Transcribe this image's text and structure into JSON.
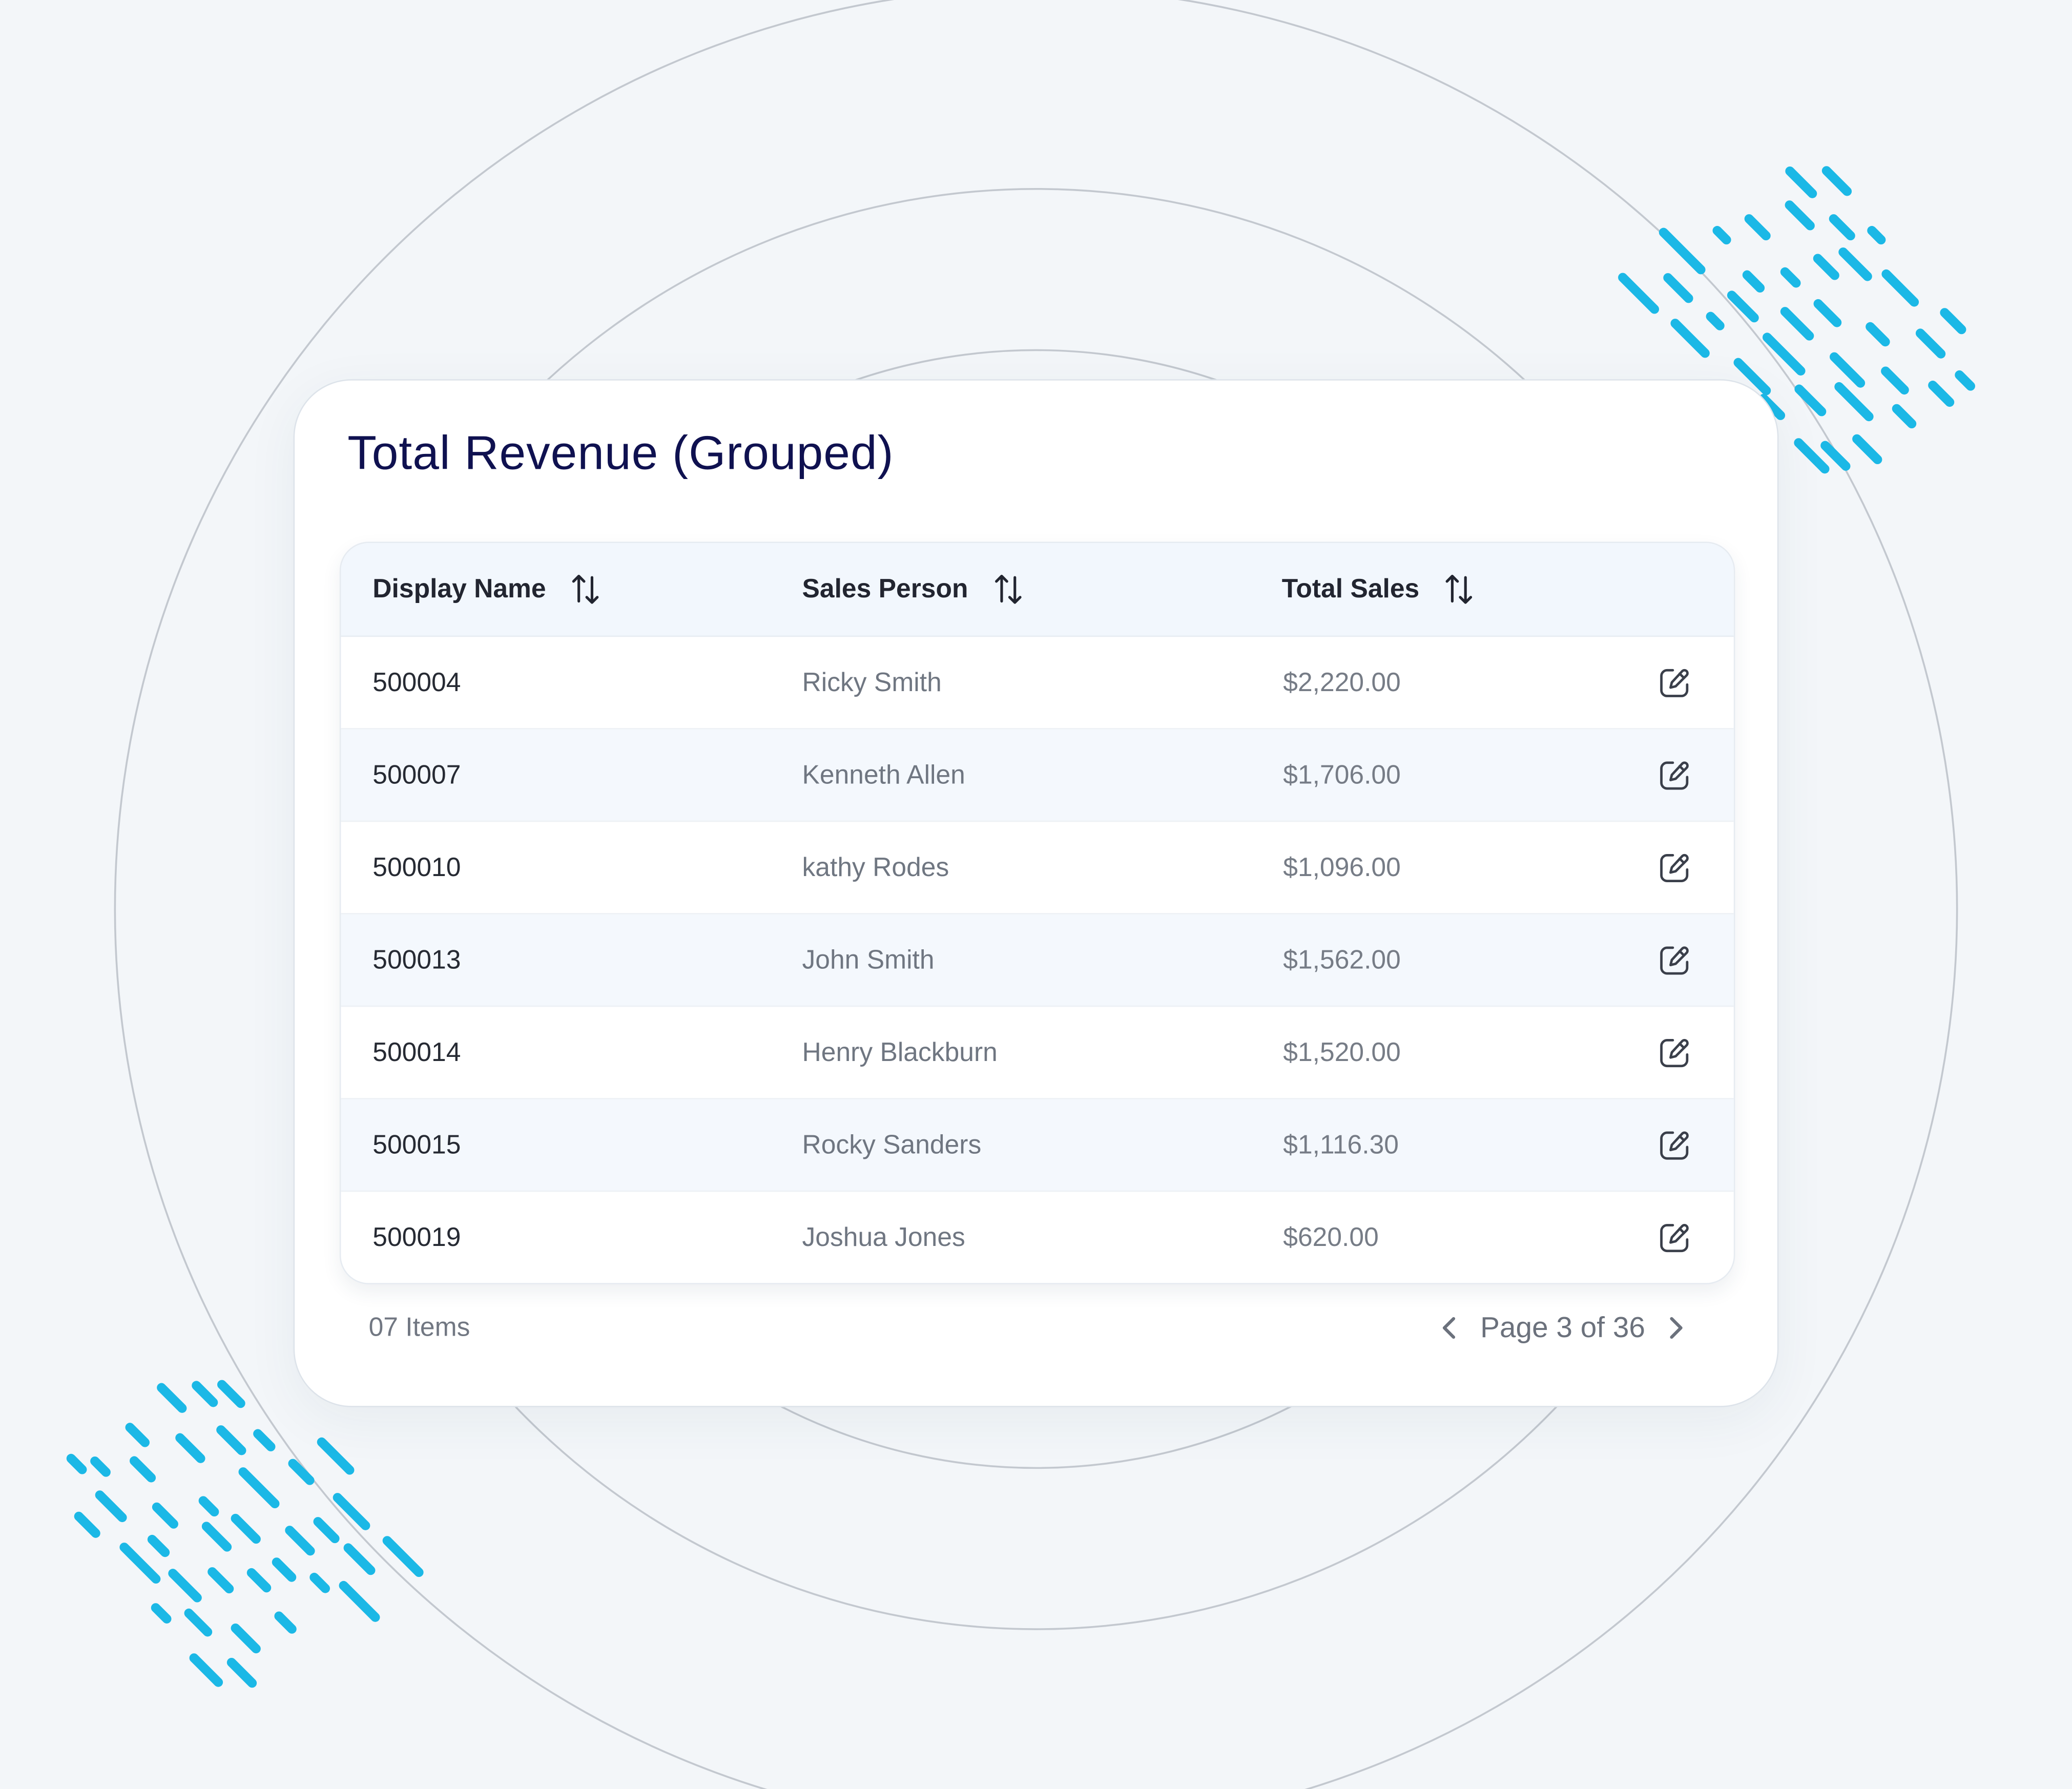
{
  "card": {
    "title": "Total Revenue (Grouped)"
  },
  "table": {
    "columns": [
      {
        "label": "Display Name",
        "sort_icon": "sort-arrows-icon"
      },
      {
        "label": "Sales Person",
        "sort_icon": "sort-arrows-icon"
      },
      {
        "label": "Total Sales",
        "sort_icon": "sort-arrows-icon"
      }
    ],
    "rows": [
      {
        "display_name": "500004",
        "sales_person": "Ricky Smith",
        "total_sales": "$2,220.00",
        "action_icon": "edit-icon"
      },
      {
        "display_name": "500007",
        "sales_person": "Kenneth Allen",
        "total_sales": "$1,706.00",
        "action_icon": "edit-icon"
      },
      {
        "display_name": "500010",
        "sales_person": "kathy Rodes",
        "total_sales": "$1,096.00",
        "action_icon": "edit-icon"
      },
      {
        "display_name": "500013",
        "sales_person": "John Smith",
        "total_sales": "$1,562.00",
        "action_icon": "edit-icon"
      },
      {
        "display_name": "500014",
        "sales_person": "Henry Blackburn",
        "total_sales": "$1,520.00",
        "action_icon": "edit-icon"
      },
      {
        "display_name": "500015",
        "sales_person": "Rocky Sanders",
        "total_sales": "$1,116.30",
        "action_icon": "edit-icon"
      },
      {
        "display_name": "500019",
        "sales_person": "Joshua Jones",
        "total_sales": "$620.00",
        "action_icon": "edit-icon"
      }
    ]
  },
  "footer": {
    "items_count": "07 Items",
    "pagination": {
      "label": "Page 3 of 36",
      "prev_icon": "chevron-left-icon",
      "next_icon": "chevron-right-icon"
    }
  },
  "colors": {
    "background": "#f3f6f9",
    "title": "#0f1150",
    "header_bg": "#f2f7fd",
    "alt_row_bg": "#f4f8fd",
    "accent_dash": "#1bb8e6",
    "ring_stroke": "#c3c8cf"
  }
}
